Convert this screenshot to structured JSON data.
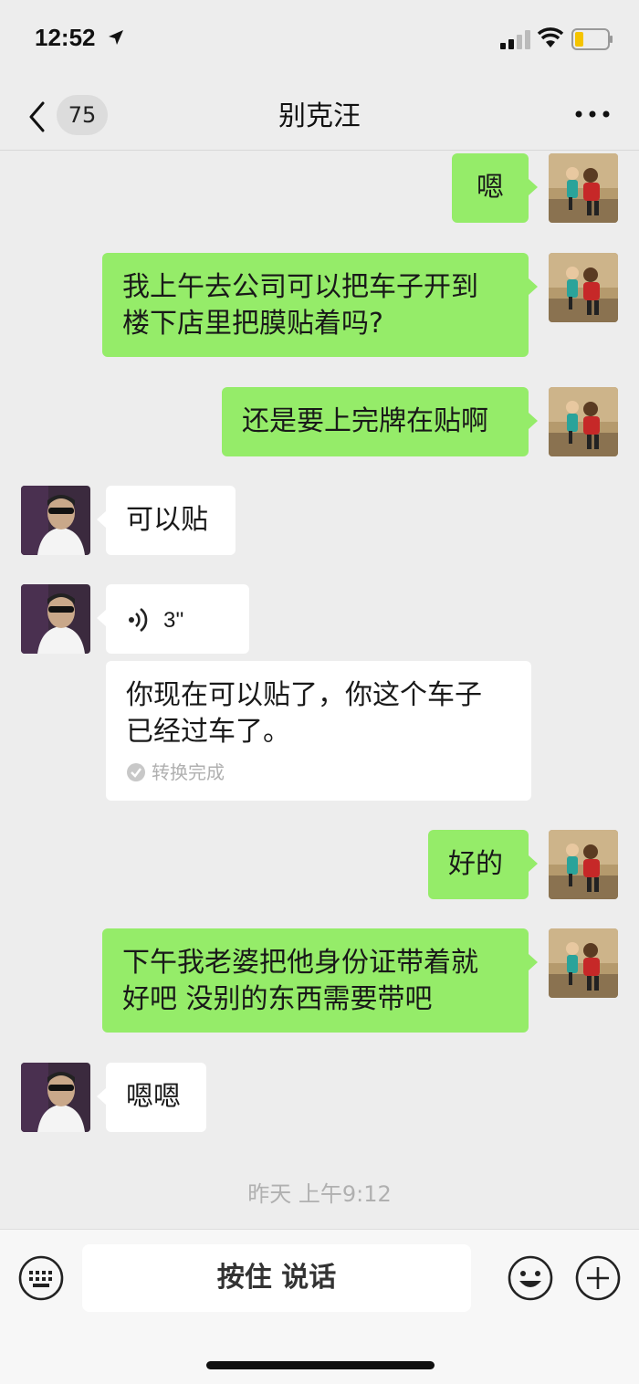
{
  "status_bar": {
    "time": "12:52",
    "location_icon": "location-arrow-icon",
    "signal_icon": "signal-bars-icon",
    "wifi_icon": "wifi-icon",
    "battery_icon": "battery-low-icon"
  },
  "header": {
    "back_icon": "chevron-left-icon",
    "unread_count": "75",
    "title": "别克汪",
    "more_icon": "more-dots-icon"
  },
  "messages": [
    {
      "side": "out",
      "lines": [
        "嗯"
      ]
    },
    {
      "side": "out",
      "lines": [
        "我上午去公司可以把车子开到",
        "楼下店里把膜贴着吗?"
      ]
    },
    {
      "side": "out",
      "lines": [
        "还是要上完牌在贴啊"
      ]
    },
    {
      "side": "in",
      "lines": [
        "可以贴"
      ]
    },
    {
      "side": "in",
      "type": "voice",
      "duration": "3''",
      "transcript": [
        "你现在可以贴了，你这个车子",
        "已经过车了。"
      ],
      "transcript_status": "转换完成"
    },
    {
      "side": "out",
      "lines": [
        "好的"
      ]
    },
    {
      "side": "out",
      "lines": [
        "下午我老婆把他身份证带着就",
        "好吧 没别的东西需要带吧"
      ]
    },
    {
      "side": "in",
      "lines": [
        "嗯嗯"
      ]
    }
  ],
  "timestamp": "昨天 上午9:12",
  "input_bar": {
    "keyboard_icon": "keyboard-icon",
    "hold_to_talk": "按住 说话",
    "emoji_icon": "emoji-icon",
    "add_icon": "plus-circle-icon"
  },
  "colors": {
    "outgoing_bubble": "#95ec69",
    "incoming_bubble": "#ffffff",
    "background": "#ededed"
  }
}
